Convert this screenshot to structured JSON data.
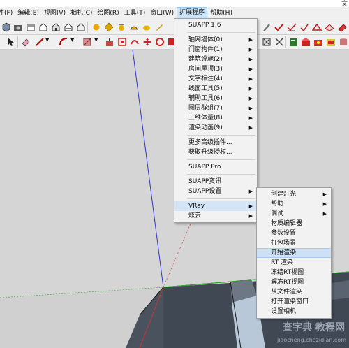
{
  "title_corner": "文",
  "menubar": [
    {
      "label": "件(F)",
      "id": "file"
    },
    {
      "label": "编辑(E)",
      "id": "edit"
    },
    {
      "label": "视图(V)",
      "id": "view"
    },
    {
      "label": "相机(C)",
      "id": "camera"
    },
    {
      "label": "绘图(R)",
      "id": "draw"
    },
    {
      "label": "工具(T)",
      "id": "tools"
    },
    {
      "label": "窗口(W)",
      "id": "window"
    },
    {
      "label": "扩展程序",
      "id": "extensions",
      "active": true
    },
    {
      "label": "帮助(H)",
      "id": "help"
    }
  ],
  "extensions_menu": {
    "header": "SUAPP 1.6",
    "group1": [
      {
        "label": "轴网墙体(0)",
        "submenu": true
      },
      {
        "label": "门窗构件(1)",
        "submenu": true
      },
      {
        "label": "建筑设施(2)",
        "submenu": true
      },
      {
        "label": "房间屋顶(3)",
        "submenu": true
      },
      {
        "label": "文字标注(4)",
        "submenu": true
      },
      {
        "label": "线面工具(5)",
        "submenu": true
      },
      {
        "label": "辅助工具(6)",
        "submenu": true
      },
      {
        "label": "图层群组(7)",
        "submenu": true
      },
      {
        "label": "三维体量(8)",
        "submenu": true
      },
      {
        "label": "渲染动画(9)",
        "submenu": true
      }
    ],
    "group2": [
      "更多高级插件...",
      "获取升级授权..."
    ],
    "pro": "SUAPP Pro",
    "group3": [
      {
        "label": "SUAPP资讯",
        "submenu": false
      },
      {
        "label": "SUAPP设置",
        "submenu": true
      }
    ],
    "vray": "VRay",
    "xuanyun": "炫云"
  },
  "vray_menu": [
    {
      "label": "创建灯光",
      "submenu": true
    },
    {
      "label": "帮助",
      "submenu": true
    },
    {
      "label": "调试",
      "submenu": true
    },
    {
      "label": "材质编辑器",
      "submenu": false
    },
    {
      "label": "参数设置",
      "submenu": false
    },
    {
      "label": "打包场景",
      "submenu": false
    },
    {
      "label": "开始渲染",
      "submenu": false,
      "highlighted": true
    },
    {
      "label": "RT 渲染",
      "submenu": false
    },
    {
      "label": "冻结RT视图",
      "submenu": false
    },
    {
      "label": "解冻RT视图",
      "submenu": false
    },
    {
      "label": "从文件渲染",
      "submenu": false
    },
    {
      "label": "打开渲染窗口",
      "submenu": false
    },
    {
      "label": "设置相机",
      "submenu": false
    }
  ],
  "watermark": {
    "top": "查字典 教程网",
    "url": "jiaocheng.chazidian.com"
  },
  "colors": {
    "menu_highlight": "#cce1f6",
    "axis_blue": "#3333cc",
    "axis_red": "#cc3333",
    "axis_green": "#33aa33"
  }
}
